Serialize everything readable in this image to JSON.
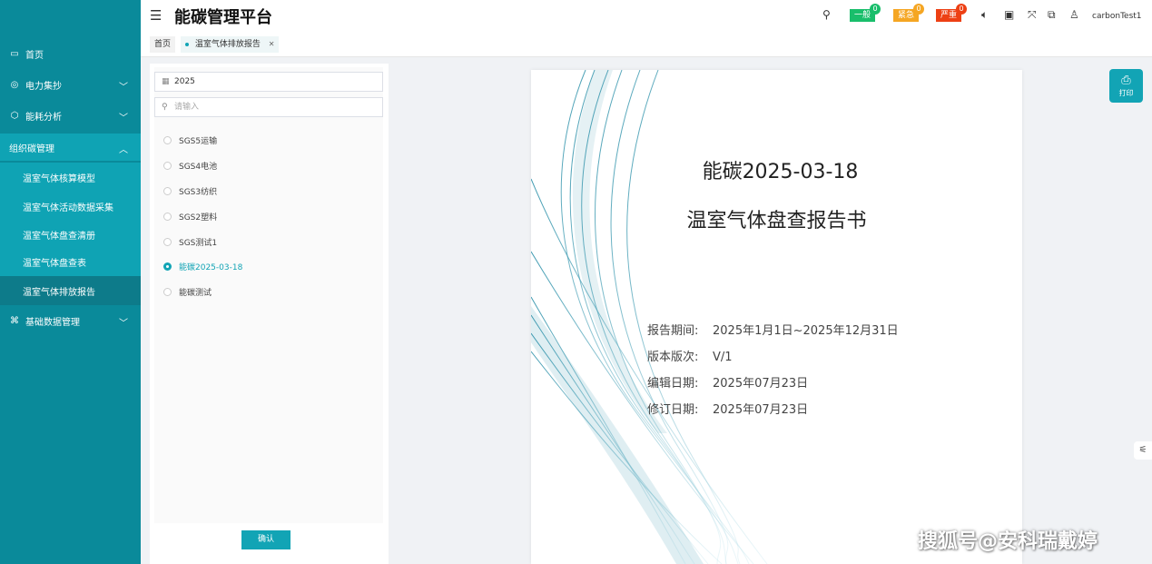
{
  "app": {
    "title": "能碳管理平台",
    "username": "carbonTest1"
  },
  "header": {
    "alerts": [
      {
        "label": "一般",
        "count": "0",
        "color": "#19be6b",
        "badge_color": "#19be6b"
      },
      {
        "label": "紧急",
        "count": "0",
        "color": "#f5a623",
        "badge_color": "#f5a623"
      },
      {
        "label": "严重",
        "count": "0",
        "color": "#ed4014",
        "badge_color": "#ed4014"
      }
    ]
  },
  "sidebar": {
    "items": [
      {
        "label": "首页"
      },
      {
        "label": "电力集抄"
      },
      {
        "label": "能耗分析"
      },
      {
        "label": "组织碳管理"
      },
      {
        "label": "温室气体核算模型"
      },
      {
        "label": "温室气体活动数据采集"
      },
      {
        "label": "温室气体盘查清册"
      },
      {
        "label": "温室气体盘查表"
      },
      {
        "label": "温室气体排放报告"
      },
      {
        "label": "基础数据管理"
      }
    ]
  },
  "tabs": [
    {
      "label": "首页"
    },
    {
      "label": "温室气体排放报告"
    }
  ],
  "panel": {
    "year_value": "2025",
    "search_placeholder": "请输入",
    "options": [
      {
        "label": "SGS5运输"
      },
      {
        "label": "SGS4电池"
      },
      {
        "label": "SGS3纺织"
      },
      {
        "label": "SGS2塑料"
      },
      {
        "label": "SGS测试1"
      },
      {
        "label": "能碳2025-03-18"
      },
      {
        "label": "能碳测试"
      }
    ],
    "selected_index": 5,
    "confirm_label": "确认"
  },
  "report": {
    "title_line1": "能碳2025-03-18",
    "title_line2": "温室气体盘查报告书",
    "meta": [
      {
        "label": "报告期间:",
        "value": "2025年1月1日~2025年12月31日"
      },
      {
        "label": "版本版次:",
        "value": "V/1"
      },
      {
        "label": "编辑日期:",
        "value": "2025年07月23日"
      },
      {
        "label": "修订日期:",
        "value": "2025年07月23日"
      }
    ]
  },
  "print": {
    "label": "打印"
  },
  "watermark": "搜狐号@安科瑞戴婷"
}
